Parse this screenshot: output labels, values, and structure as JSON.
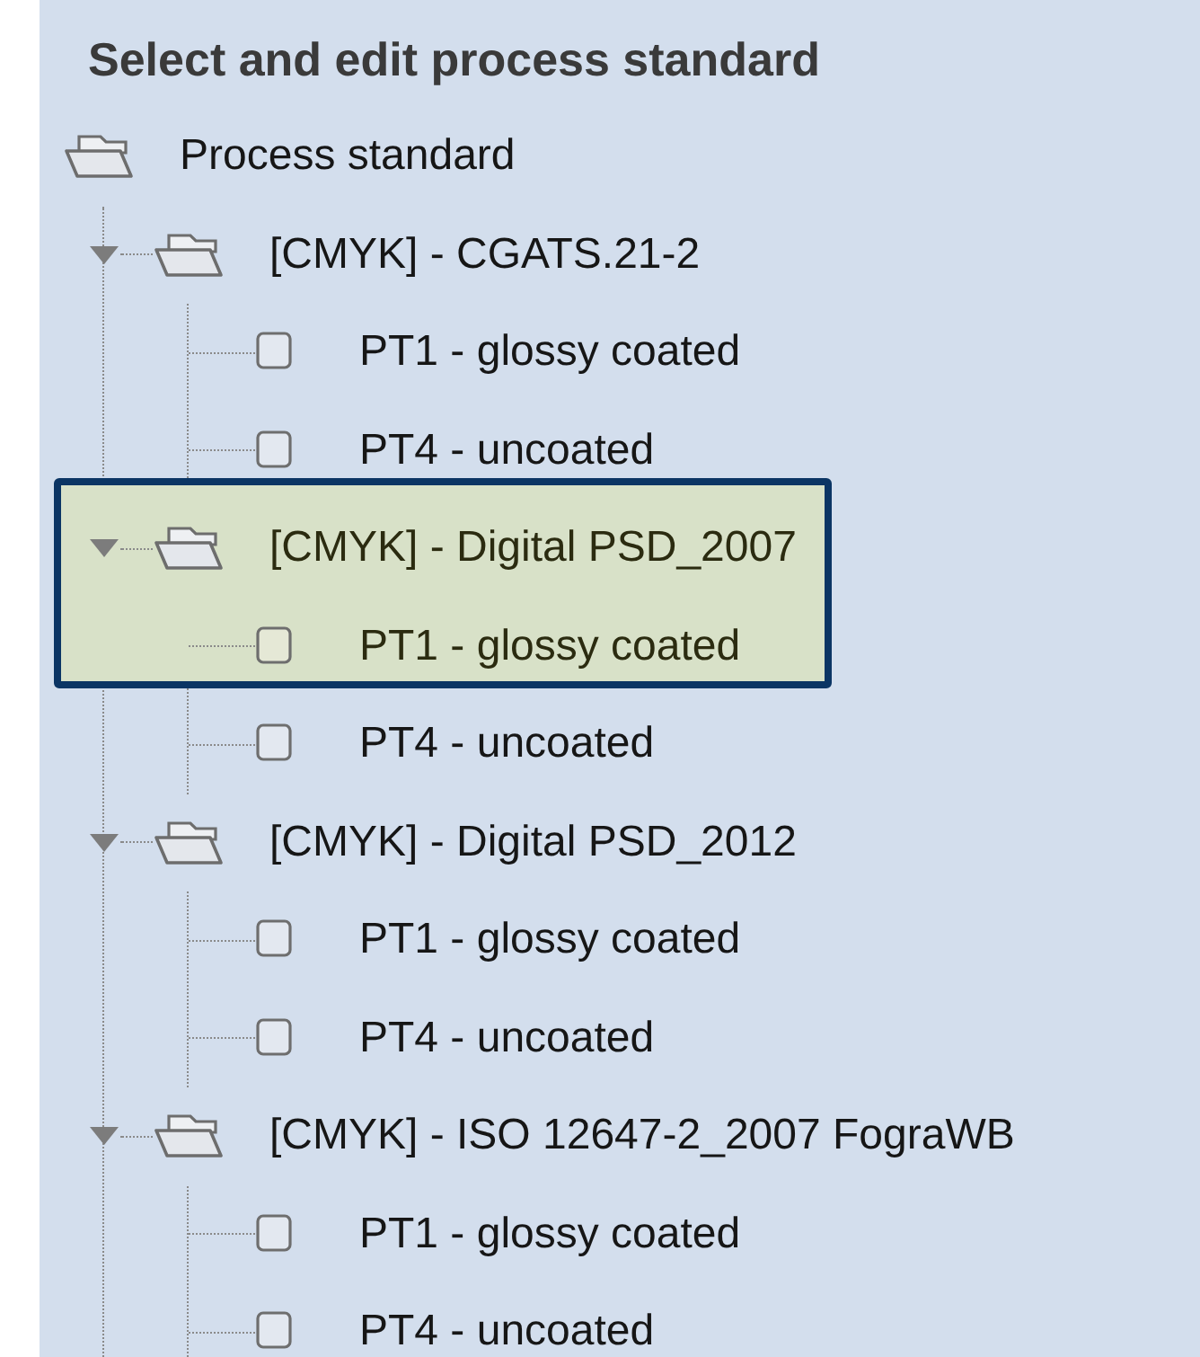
{
  "title": "Select and edit process standard",
  "tree": {
    "label": "Process standard",
    "children": [
      {
        "label": "[CMYK] - CGATS.21-2",
        "expanded": true,
        "highlighted": false,
        "children": [
          {
            "label": "PT1 - glossy coated",
            "highlighted": false
          },
          {
            "label": "PT4 - uncoated",
            "highlighted": false
          }
        ]
      },
      {
        "label": "[CMYK] - Digital PSD_2007",
        "expanded": true,
        "highlighted": true,
        "children": [
          {
            "label": "PT1 - glossy coated",
            "highlighted": true
          },
          {
            "label": "PT4 - uncoated",
            "highlighted": false
          }
        ]
      },
      {
        "label": "[CMYK] - Digital PSD_2012",
        "expanded": true,
        "highlighted": false,
        "children": [
          {
            "label": "PT1 - glossy coated",
            "highlighted": false
          },
          {
            "label": "PT4 - uncoated",
            "highlighted": false
          }
        ]
      },
      {
        "label": "[CMYK] - ISO 12647-2_2007 FograWB",
        "expanded": true,
        "highlighted": false,
        "children": [
          {
            "label": "PT1 - glossy coated",
            "highlighted": false
          },
          {
            "label": "PT4 - uncoated",
            "highlighted": false
          }
        ]
      }
    ]
  }
}
